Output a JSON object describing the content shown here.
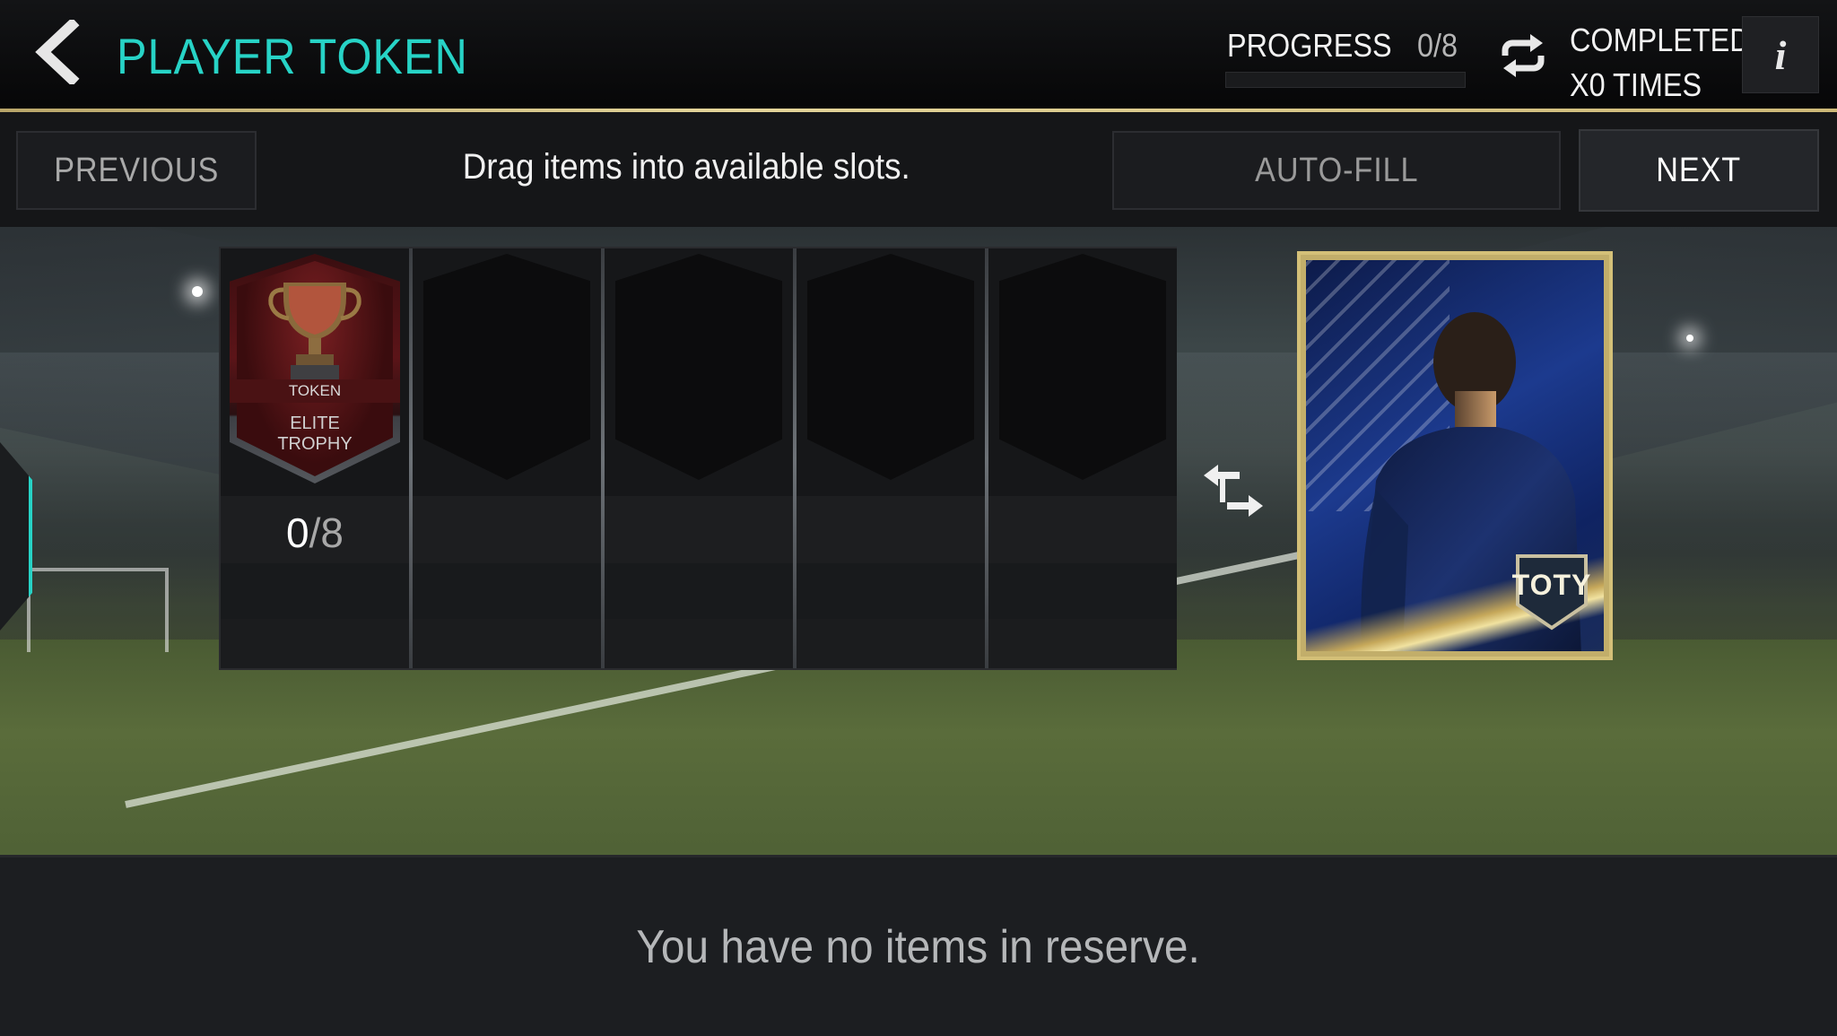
{
  "header": {
    "title": "PLAYER TOKEN",
    "progress_label": "PROGRESS",
    "progress_value": "0/8",
    "progress_fraction": 0,
    "completed_line1": "COMPLETED",
    "completed_line2": "X0 TIMES",
    "info_glyph": "i"
  },
  "actions": {
    "previous": "PREVIOUS",
    "instruction": "Drag items into available slots.",
    "auto_fill": "AUTO-FILL",
    "next": "NEXT"
  },
  "slots": {
    "token": {
      "label": "TOKEN",
      "name_line1": "ELITE",
      "name_line2": "TROPHY",
      "current": "0",
      "separator": "/",
      "required": "8"
    },
    "empty_slots": 4
  },
  "reward": {
    "badge": "TOTY"
  },
  "reserve": {
    "message": "You have no items in reserve."
  },
  "colors": {
    "accent": "#27d3c6",
    "gold": "#d4c078"
  }
}
